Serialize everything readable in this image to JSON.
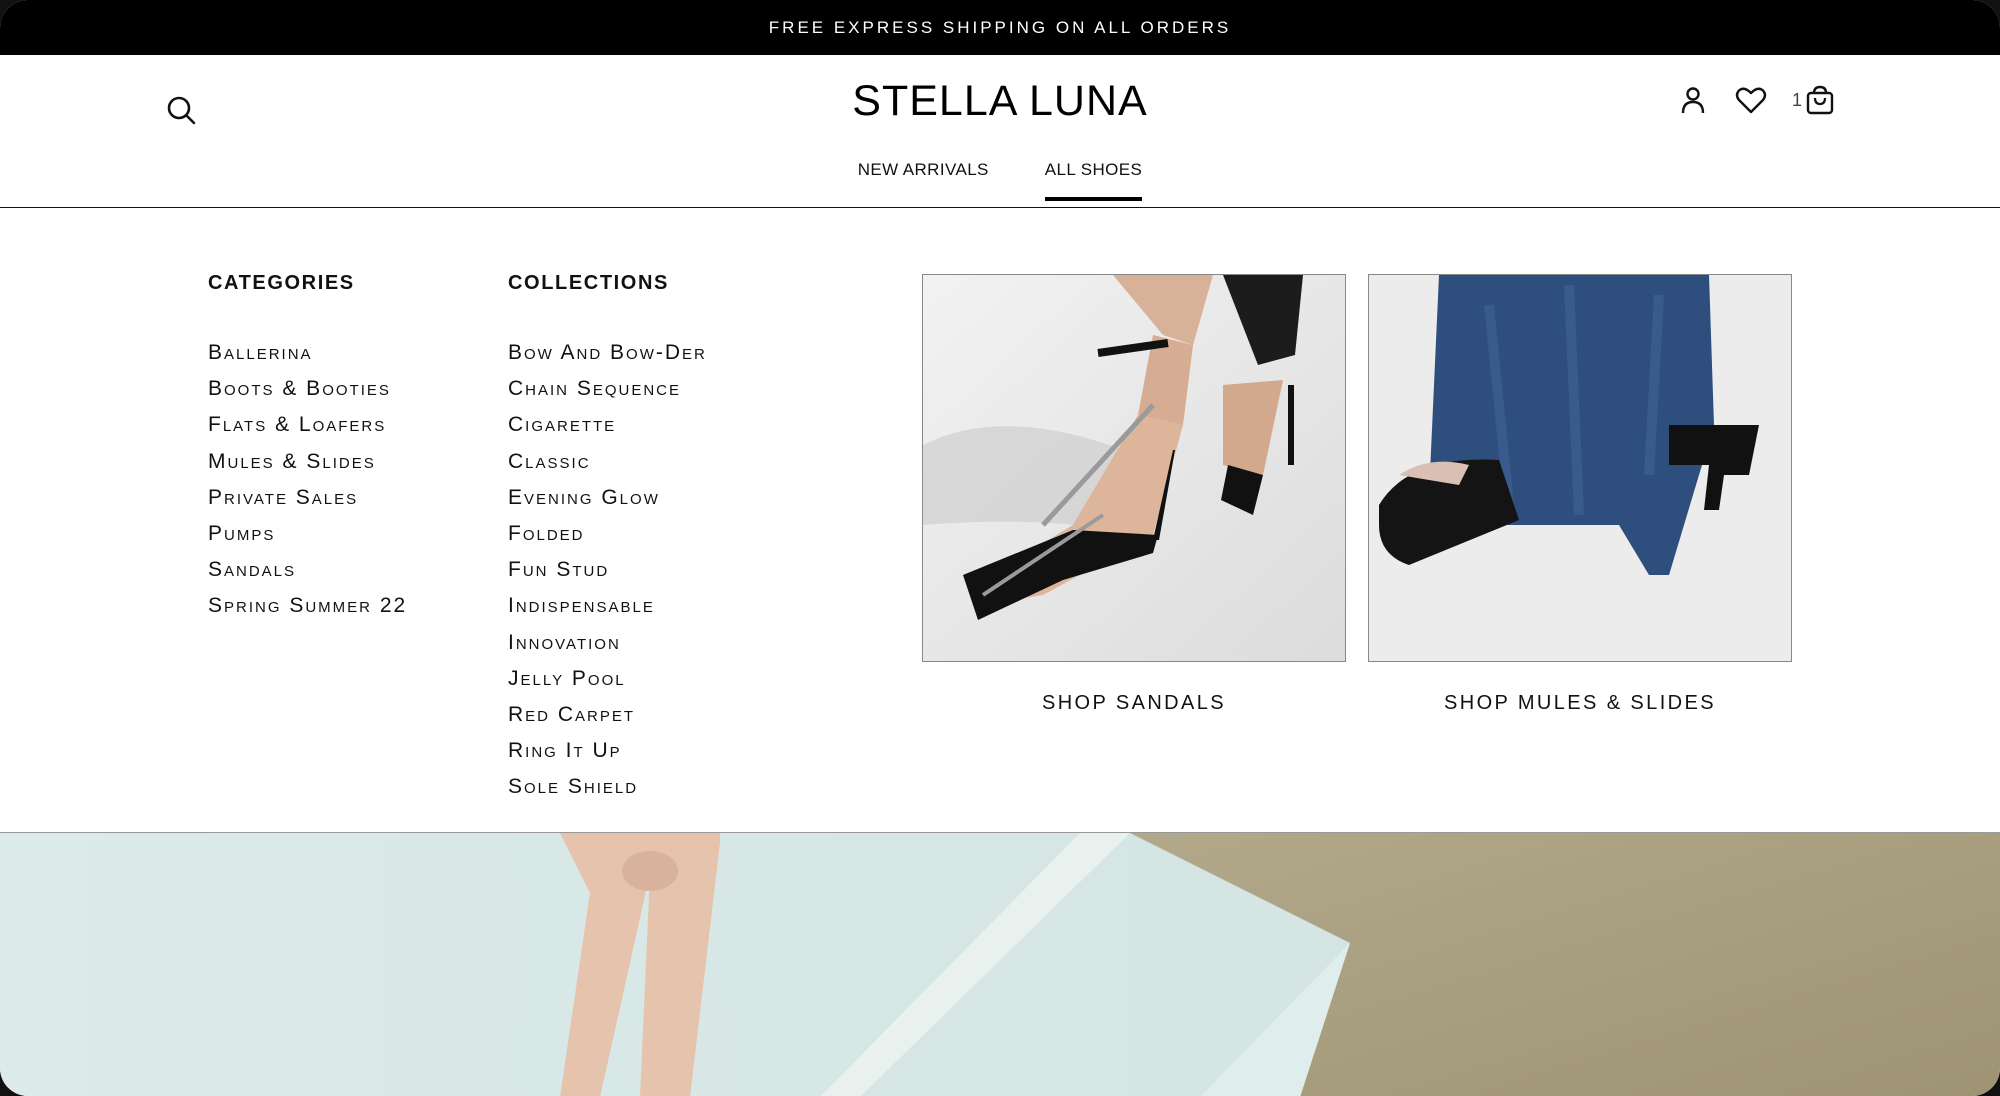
{
  "promo_bar": {
    "text": "FREE EXPRESS SHIPPING ON ALL ORDERS"
  },
  "header": {
    "logo": "STELLA LUNA",
    "search_icon": "search-icon",
    "account_icon": "user-icon",
    "wishlist_icon": "heart-icon",
    "cart_icon": "shopping-bag-icon",
    "cart_count": "1"
  },
  "nav": {
    "items": [
      {
        "label": "NEW ARRIVALS",
        "active": false
      },
      {
        "label": "ALL SHOES",
        "active": true
      }
    ]
  },
  "mega_menu": {
    "categories": {
      "heading": "CATEGORIES",
      "items": [
        "Ballerina",
        "Boots & Booties",
        "Flats & Loafers",
        "Mules & Slides",
        "Private Sales",
        "Pumps",
        "Sandals",
        "Spring Summer 22"
      ]
    },
    "collections": {
      "heading": "COLLECTIONS",
      "items": [
        "Bow And Bow-Der",
        "Chain Sequence",
        "Cigarette",
        "Classic",
        "Evening Glow",
        "Folded",
        "Fun Stud",
        "Indispensable",
        "Innovation",
        "Jelly Pool",
        "Red Carpet",
        "Ring It Up",
        "Sole Shield"
      ]
    },
    "promos": [
      {
        "label": "SHOP SANDALS"
      },
      {
        "label": "SHOP MULES & SLIDES"
      }
    ]
  },
  "colors": {
    "promo_bg": "#000000",
    "text": "#111111",
    "background": "#ffffff"
  }
}
